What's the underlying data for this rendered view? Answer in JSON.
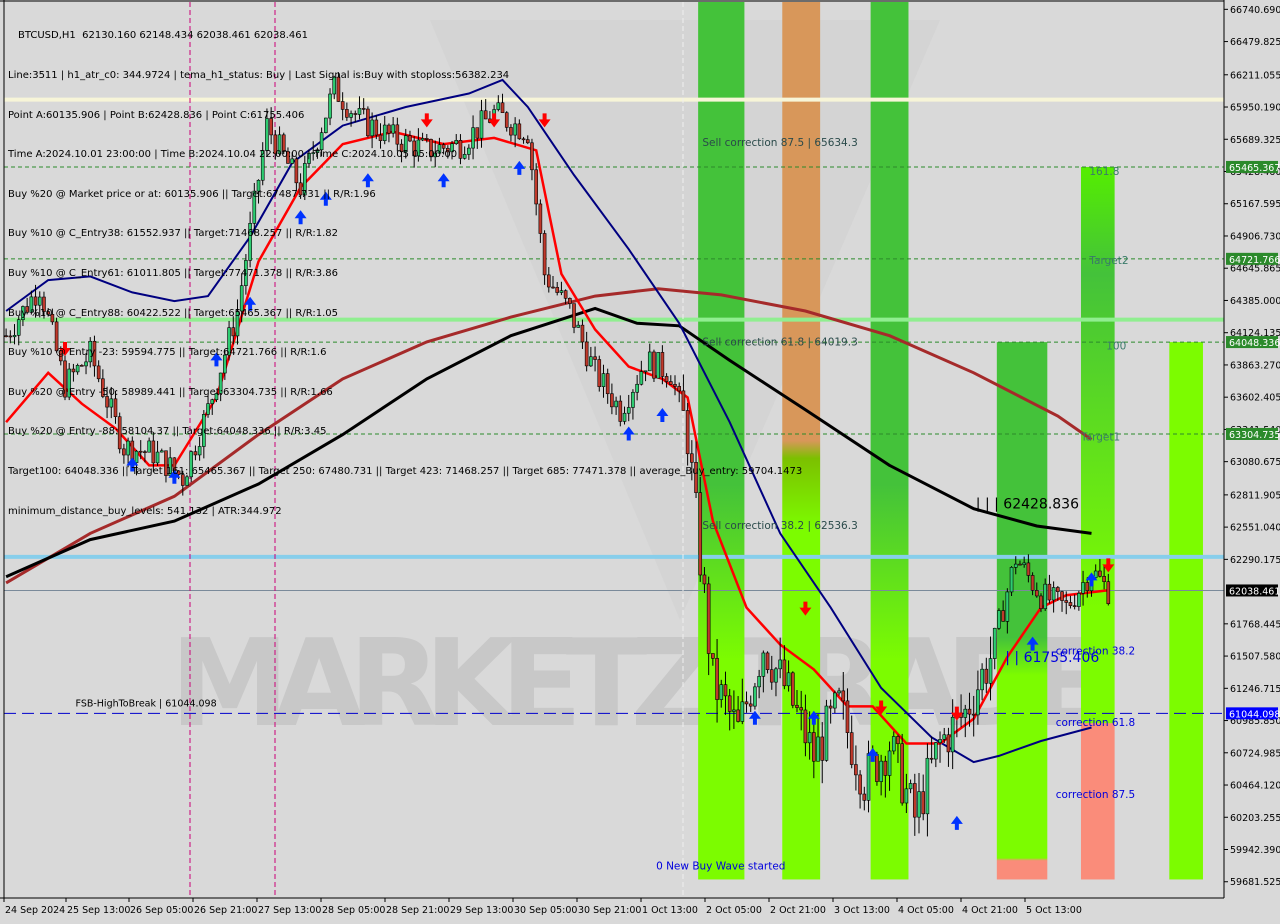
{
  "window": {
    "symbol_line": "BTCUSD,H1  62130.160 62148.434 62038.461 62038.461"
  },
  "info_lines": [
    "Line:3511 | h1_atr_c0: 344.9724 | tema_h1_status: Buy | Last Signal is:Buy with stoploss:56382.234",
    "Point A:60135.906 | Point B:62428.836 | Point C:61755.406",
    "Time A:2024.10.01 23:00:00 | Time B:2024.10.04 22:00:00 | Time C:2024.10.05 05:00:00",
    "Buy %20 @ Market price or at: 60135.906 || Target:67487.731 || R/R:1.96",
    "Buy %10 @ C_Entry38: 61552.937 || Target:71468.257 || R/R:1.82",
    "Buy %10 @ C_Entry61: 61011.805 || Target:77471.378 || R/R:3.86",
    "Buy %10 @ C_Entry88: 60422.522 || Target:65465.367 || R/R:1.05",
    "Buy %10 @ Entry -23: 59594.775 || Target:64721.766 || R/R:1.6",
    "Buy %20 @ Entry -50: 58989.441 || Target:63304.735 || R/R:1.66",
    "Buy %20 @ Entry -88: 58104.37 || Target:64048.336 || R/R:3.45",
    "Target100: 64048.336 || Target 161: 65465.367 || Target 250: 67480.731 || Target 423: 71468.257 || Target 685: 77471.378 || average_Buy_entry: 59704.1473",
    "minimum_distance_buy_levels: 541.132 | ATR:344.972"
  ],
  "colors": {
    "background": "#d9d9d9",
    "bull_candle": "#2ecc71",
    "bear_candle": "#c0392b",
    "tema_fast": "#ff0000",
    "ma_blue": "#000080",
    "ma_brown": "#a52a2a",
    "ma_black": "#000000",
    "zone_green": "#44c23a",
    "zone_lime": "#7cfc00",
    "zone_orange": "#d8975a",
    "zone_salmon": "#fa8c7a",
    "level_green_tag": "#2b8a2b",
    "level_blue_tag": "#0000ff",
    "current_price_tag": "#000000",
    "light_blue_line": "#87ceeb",
    "light_green_line": "#90ee90",
    "light_yellow_line": "#f5f5dc",
    "magenta_vline": "#cc0077"
  },
  "chart_data": {
    "type": "candlestick",
    "title": "BTCUSD,H1",
    "ohlc_header": {
      "open": 62130.16,
      "high": 62148.434,
      "low": 62038.461,
      "close": 62038.461
    },
    "ylim": [
      59550,
      66800
    ],
    "y_ticks": [
      66740.69,
      66479.825,
      66211.055,
      65950.19,
      65689.325,
      65428.46,
      65167.595,
      64906.73,
      64645.865,
      64385.0,
      64124.135,
      63863.27,
      63602.405,
      63341.54,
      63080.675,
      62811.905,
      62551.04,
      62290.175,
      61768.445,
      61507.58,
      61246.715,
      60985.85,
      60724.985,
      60464.12,
      60203.255,
      59942.39,
      59681.525
    ],
    "x_ticks": [
      "24 Sep 2024",
      "25 Sep 13:00",
      "26 Sep 05:00",
      "26 Sep 21:00",
      "27 Sep 13:00",
      "28 Sep 05:00",
      "28 Sep 21:00",
      "29 Sep 13:00",
      "30 Sep 05:00",
      "30 Sep 21:00",
      "1 Oct 13:00",
      "2 Oct 05:00",
      "2 Oct 21:00",
      "3 Oct 13:00",
      "4 Oct 05:00",
      "4 Oct 21:00",
      "5 Oct 13:00"
    ],
    "price_tags": [
      {
        "label": "65465.367",
        "value": 65465.367,
        "style": "green"
      },
      {
        "label": "64721.766",
        "value": 64721.766,
        "style": "green"
      },
      {
        "label": "64048.336",
        "value": 64048.336,
        "style": "green"
      },
      {
        "label": "63304.735",
        "value": 63304.735,
        "style": "green"
      },
      {
        "label": "62038.461",
        "value": 62038.461,
        "style": "current"
      },
      {
        "label": "61044.098",
        "value": 61044.098,
        "style": "blue"
      }
    ],
    "horizontal_levels": [
      {
        "name": "target-161",
        "value": 65465.367,
        "style": "green-dashed"
      },
      {
        "name": "target-2",
        "value": 64721.766,
        "style": "green-dashed"
      },
      {
        "name": "target-100",
        "value": 64048.336,
        "style": "green-dashed"
      },
      {
        "name": "target-1",
        "value": 63304.735,
        "style": "green-dashed"
      },
      {
        "name": "fsb-high-to-break",
        "value": 61044.098,
        "style": "blue-dashed"
      },
      {
        "name": "light-yellow-level",
        "value": 66010,
        "style": "light-yellow"
      },
      {
        "name": "light-green-level",
        "value": 64230,
        "style": "light-green"
      },
      {
        "name": "light-blue-level",
        "value": 62310,
        "style": "light-blue"
      },
      {
        "name": "current-price",
        "value": 62038.461,
        "style": "gray-thin"
      }
    ],
    "annotations": [
      {
        "text": "Sell correction 87.5 | 65634.3",
        "x_idx": 166,
        "y": 65634.3
      },
      {
        "text": "Sell correction 61.8 | 64019.3",
        "x_idx": 166,
        "y": 64019.3
      },
      {
        "text": "Sell correction 38.2 | 62536.3",
        "x_idx": 166,
        "y": 62536.3
      },
      {
        "text": "161.8",
        "x_idx": 258,
        "y": 65400
      },
      {
        "text": "Target2",
        "x_idx": 258,
        "y": 64680
      },
      {
        "text": "100",
        "x_idx": 262,
        "y": 63990
      },
      {
        "text": "Target1",
        "x_idx": 256,
        "y": 63250
      },
      {
        "text": "| | | 62428.836",
        "x_idx": 231,
        "y": 62700
      },
      {
        "text": "| | 61755.406",
        "x_idx": 238,
        "y": 61460
      },
      {
        "text": "correction 38.2",
        "x_idx": 250,
        "y": 61520
      },
      {
        "text": "correction 61.8",
        "x_idx": 250,
        "y": 60940
      },
      {
        "text": "correction 87.5",
        "x_idx": 250,
        "y": 60360
      },
      {
        "text": "0 New Buy Wave started",
        "x_idx": 155,
        "y": 59780
      },
      {
        "text": "FSB-HighToBreak | 61044.098",
        "x_idx": 17,
        "y": 61100
      }
    ],
    "zones": [
      {
        "x0": 165,
        "x1": 176,
        "from": 59700,
        "to": 66800,
        "color": "green-lime"
      },
      {
        "x0": 185,
        "x1": 194,
        "from": 59700,
        "to": 66800,
        "color": "orange-lime"
      },
      {
        "x0": 206,
        "x1": 215,
        "from": 59700,
        "to": 66800,
        "color": "green-lime"
      },
      {
        "x0": 236,
        "x1": 248,
        "from": 59700,
        "to": 64048,
        "color": "green-lime-salmon"
      },
      {
        "x0": 256,
        "x1": 264,
        "from": 59700,
        "to": 65465,
        "color": "green-lime-salmon2"
      },
      {
        "x0": 277,
        "x1": 285,
        "from": 59700,
        "to": 64048,
        "color": "lime"
      }
    ],
    "series_names": [
      "TEMA fast (red)",
      "MA blue",
      "MA brown",
      "MA black"
    ]
  },
  "watermark": "MARKETZITRADE"
}
